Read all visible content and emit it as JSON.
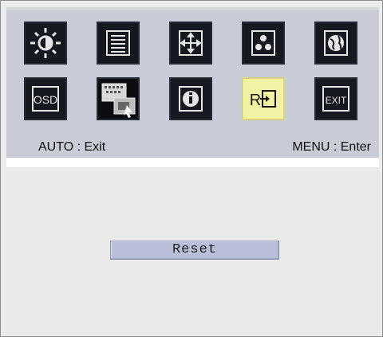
{
  "menu": {
    "icons": [
      {
        "name": "brightness-icon",
        "selected": false
      },
      {
        "name": "image-setup-icon",
        "selected": false
      },
      {
        "name": "position-icon",
        "selected": false
      },
      {
        "name": "color-icon",
        "selected": false
      },
      {
        "name": "language-icon",
        "selected": false
      },
      {
        "name": "osd-icon",
        "text": "OSD",
        "selected": false
      },
      {
        "name": "input-signal-icon",
        "selected": false
      },
      {
        "name": "information-icon",
        "selected": false
      },
      {
        "name": "reset-icon",
        "text": "R",
        "selected": true
      },
      {
        "name": "exit-icon",
        "text": "EXIT",
        "selected": false
      }
    ],
    "hint_left": "AUTO : Exit",
    "hint_right": "MENU : Enter"
  },
  "content": {
    "reset_label": "Reset"
  },
  "colors": {
    "panel": "#c9ccd7",
    "selected_icon": "#f3f2a4",
    "button": "#b9bfd9"
  }
}
